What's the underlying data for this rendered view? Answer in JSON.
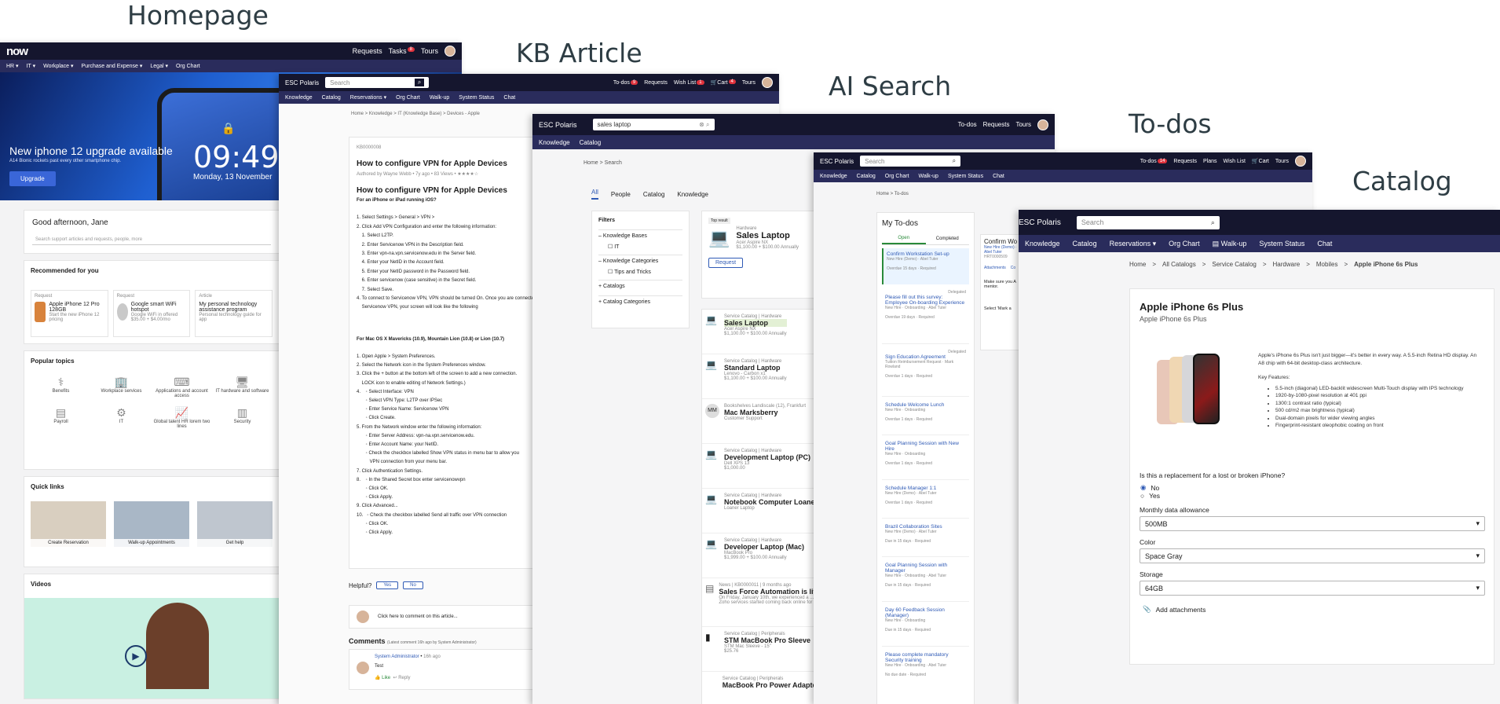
{
  "sections": {
    "homepage": "Homepage",
    "kb": "KB Article",
    "ai": "AI Search",
    "todos": "To-dos",
    "catalog": "Catalog"
  },
  "colors": {
    "topbar": "#15162e",
    "navbar": "#2a2c5c",
    "link": "#2f5ab5",
    "badge": "#e0323c"
  },
  "home": {
    "logo": "now",
    "top_links": [
      "Requests",
      "Tasks",
      "Tours"
    ],
    "tasks_badge": "8",
    "nav": [
      "HR ▾",
      "IT ▾",
      "Workplace ▾",
      "Purchase and Expense ▾",
      "Legal ▾",
      "Org Chart"
    ],
    "hero_title": "New iphone 12 upgrade available",
    "hero_sub": "A14 Bionic rockets past every other smartphone chip.",
    "hero_button": "Upgrade",
    "clock_time": "09:49",
    "clock_date": "Monday, 13 November",
    "greeting": "Good afternoon, Jane",
    "search_placeholder": "Search support articles and requests, people, more",
    "recommended_title": "Recommended for you",
    "recs": [
      {
        "kind": "Request",
        "title": "Apple iPhone 12 Pro 128GB",
        "desc": "Start the new iPhone 12 pricing"
      },
      {
        "kind": "Request",
        "title": "Google smart WiFi hotspot",
        "desc": "Google WiFi in offered $35.00 + $4.00/mo"
      },
      {
        "kind": "Article",
        "title": "My personal technology assistance program",
        "desc": "Personal technology guide for app"
      }
    ],
    "topics_title": "Popular topics",
    "topics": [
      "Benefits",
      "Workplace services",
      "Applications and account access",
      "IT hardware and software",
      "Payroll",
      "IT",
      "Global talent HR lorem two lines",
      "Security"
    ],
    "quick_title": "Quick links",
    "quick": [
      "Create Reservation",
      "Walk-up Appointments",
      "Get help"
    ],
    "videos_title": "Videos"
  },
  "kb": {
    "brand": "ESC Polaris",
    "search_placeholder": "Search",
    "top_links": [
      "To-dos",
      "Requests",
      "Wish List",
      "Cart",
      "Tours"
    ],
    "todo_badge": "9",
    "wish_badge": "1",
    "cart_badge": "4",
    "nav": [
      "Knowledge",
      "Catalog",
      "Reservations ▾",
      "Org Chart",
      "Walk-up",
      "System Status",
      "Chat"
    ],
    "breadcrumb": [
      "Home",
      "Knowledge",
      "IT (Knowledge Base)",
      "Devices - Apple"
    ],
    "number": "KB0000008",
    "title": "How to configure VPN for Apple Devices",
    "meta": "Authored by Wayne Webb • 7y ago • 83 Views • ★★★★☆",
    "heading": "How to configure VPN for Apple Devices",
    "ios_heading": "For an iPhone or iPad running iOS?",
    "lines": [
      "1. Select Settings > General > VPN >",
      "2. Click Add VPN Configuration and enter the following information:",
      "    1. Select L2TP.",
      "    2. Enter Servicenow VPN in the Description field.",
      "    3. Enter vpn-na.vpn.servicenow.edu in the Server field.",
      "    4. Enter your NetID in the Account field.",
      "    5. Enter your NetID password in the Password field.",
      "    6. Enter servicenow (case sensitive) in the Secret field.",
      "    7. Select Save.",
      "4. To connect to Servicenow VPN, VPN should be turned On. Once you are connected to",
      "    Servicenow VPN, your screen will look like the following"
    ],
    "mac_heading": "For Mac OS X Mavericks (10.9), Mountain Lion (10.8) or Lion (10.7)",
    "mac_lines": [
      "1. Open Apple > System Preferences.",
      "2. Select the Network icon in the System Preferences window.",
      "3. Click the + button at the bottom left of the screen to add a new connection.",
      "    LOCK icon to enable editing of Network Settings.)",
      "4.    ◦ Select Interface: VPN",
      "       ◦ Select VPN Type: L2TP over IPSec",
      "       ◦ Enter Service Name: Servicenow VPN",
      "       ◦ Click Create.",
      "5. From the Network window enter the following information:",
      "       ◦ Enter Server Address: vpn-na.vpn.servicenow.edu.",
      "       ◦ Enter Account Name: your NetID.",
      "       ◦ Check the checkbox labelled Show VPN status in menu bar to allow you",
      "          VPN connection from your menu bar.",
      "7. Click Authentication Settings.",
      "8.    ◦ In the Shared Secret box enter servicenowvpn",
      "       ◦ Click OK.",
      "       ◦ Click Apply.",
      "9. Click Advanced...",
      "10.   ◦ Check the checkbox labelled Send all traffic over VPN connection",
      "       ◦ Click OK.",
      "       ◦ Click Apply."
    ],
    "helpful": "Helpful?",
    "yes": "Yes",
    "no": "No",
    "comment_placeholder": "Click here to comment on this article...",
    "comments_title": "Comments",
    "comments_meta": "(Latest comment 16h ago by System Administrator)",
    "commenter": "System Administrator",
    "comment_time": "16h ago",
    "comment_text": "Test",
    "like": "Like",
    "reply": "Reply"
  },
  "ai": {
    "brand": "ESC Polaris",
    "query": "sales laptop",
    "top_links": [
      "To-dos",
      "Requests",
      "Tours"
    ],
    "nav": [
      "Knowledge",
      "Catalog"
    ],
    "breadcrumb": [
      "Home",
      "Search"
    ],
    "tabs": [
      "All",
      "People",
      "Catalog",
      "Knowledge"
    ],
    "filters_title": "Filters",
    "filters": [
      {
        "group": "Knowledge Bases",
        "items": [
          "IT"
        ]
      },
      {
        "group": "Knowledge Categories",
        "items": [
          "Tips and Tricks"
        ]
      },
      {
        "group": "Catalogs",
        "items": []
      },
      {
        "group": "Catalog Categories",
        "items": []
      }
    ],
    "top_result": {
      "badge": "Top result",
      "category": "Hardware",
      "title": "Sales Laptop",
      "sub": "Acer Aspire NX",
      "price": "$1,100.00 + $100.00 Annually",
      "button": "Request"
    },
    "results": [
      {
        "cat": "Service Catalog | Hardware",
        "title": "Sales Laptop",
        "sub": "Acer Aspire NX",
        "price": "$1,100.00 + $100.00 Annually"
      },
      {
        "cat": "Service Catalog | Hardware",
        "title": "Standard Laptop",
        "sub": "Lenovo - Carbon x1",
        "price": "$1,100.00 + $100.00 Annually"
      },
      {
        "cat": "Bookshelves Landiscale (12), Frankfurt",
        "title": "Mac Marksberry",
        "sub": "Customer Support",
        "price": ""
      },
      {
        "cat": "Service Catalog | Hardware",
        "title": "Development Laptop (PC)",
        "sub": "Dell XPS 13",
        "price": "$1,000.00"
      },
      {
        "cat": "Service Catalog | Hardware",
        "title": "Notebook Computer Loaner",
        "sub": "Loaner Laptop",
        "price": ""
      },
      {
        "cat": "Service Catalog | Hardware",
        "title": "Developer Laptop (Mac)",
        "sub": "MacBook Pro",
        "price": "$1,999.00 + $100.00 Annually"
      },
      {
        "cat": "News | KB0000011 | 9 months ago",
        "title": "Sales Force Automation is live",
        "sub": "On Friday, January 10th, we experienced a ...",
        "price": "Zoho services started coming back online for ..."
      },
      {
        "cat": "Service Catalog | Peripherals",
        "title": "STM MacBook Pro Sleeve",
        "sub": "STM Mac Sleeve - 15\"",
        "price": "$25.76"
      },
      {
        "cat": "Service Catalog | Peripherals",
        "title": "MacBook Pro Power Adapter",
        "sub": "",
        "price": ""
      }
    ]
  },
  "todos": {
    "brand": "ESC Polaris",
    "search_placeholder": "Search",
    "top_links": [
      "To-dos",
      "Requests",
      "Plans",
      "Wish List",
      "Cart",
      "Tours"
    ],
    "todo_badge": "14",
    "nav": [
      "Knowledge",
      "Catalog",
      "Org Chart",
      "Walk-up",
      "System Status",
      "Chat"
    ],
    "breadcrumb": [
      "Home",
      "To-dos"
    ],
    "title": "My To-dos",
    "tabs": [
      "Open",
      "Completed"
    ],
    "items": [
      {
        "title": "Confirm Workstation Set-up",
        "sub": "New Hire (Demo) · Abel Tuter",
        "meta": "Overdue 15 days · Required",
        "tag": ""
      },
      {
        "title": "Please fill out this survey: Employee On-boarding Experience",
        "sub": "New Hire · Onboarding · Abel Tuter",
        "meta": "Overdue 19 days · Required",
        "tag": "Delegated"
      },
      {
        "title": "Sign Education Agreement",
        "sub": "Tuition Reimbursement Request · Mark Rowland",
        "meta": "Overdue 1 days · Required",
        "tag": "Delegated"
      },
      {
        "title": "Schedule Welcome Lunch",
        "sub": "New Hire · Onboarding",
        "meta": "Overdue 1 days · Required",
        "tag": ""
      },
      {
        "title": "Goal Planning Session with New Hire",
        "sub": "New Hire · Onboarding",
        "meta": "Overdue 1 days · Required",
        "tag": ""
      },
      {
        "title": "Schedule Manager 1:1",
        "sub": "New Hire (Demo) · Abel Tuter",
        "meta": "Overdue 1 days · Required",
        "tag": ""
      },
      {
        "title": "Brazil Collaboration Sites",
        "sub": "New Hire (Demo) · Abel Tuter",
        "meta": "Due in 15 days · Required",
        "tag": ""
      },
      {
        "title": "Goal Planning Session with Manager",
        "sub": "New Hire · Onboarding · Abel Tuter",
        "meta": "Due in 15 days · Required",
        "tag": ""
      },
      {
        "title": "Day 60 Feedback Session (Manager)",
        "sub": "New Hire · Onboarding",
        "meta": "Due in 15 days · Required",
        "tag": ""
      },
      {
        "title": "Please complete mandatory Security training",
        "sub": "New Hire · Onboarding · Abel Tuter",
        "meta": "No due date · Required",
        "tag": ""
      }
    ],
    "detail_title": "Confirm Wo",
    "detail_sub": "New Hire (Demo) · Abel Tuter",
    "detail_num": "HRT0000509",
    "detail_tabs": [
      "Attachments",
      "Co"
    ],
    "detail_text": "Make sure you A mentor.",
    "detail_select": "Select 'Mark a"
  },
  "catalog": {
    "brand": "ESC Polaris",
    "search_placeholder": "Search",
    "nav": [
      "Knowledge",
      "Catalog",
      "Reservations ▾",
      "Org Chart",
      "Walk-up",
      "System Status",
      "Chat"
    ],
    "breadcrumb": [
      "Home",
      "All Catalogs",
      "Service Catalog",
      "Hardware",
      "Mobiles",
      "Apple iPhone 6s Plus"
    ],
    "title": "Apple iPhone 6s Plus",
    "subtitle": "Apple iPhone 6s Plus",
    "desc": "Apple's iPhone 6s Plus isn't just bigger—it's better in every way. A 5.5-inch Retina HD display. An A8 chip with 64-bit desktop-class architecture.",
    "features_title": "Key Features:",
    "features": [
      "5.5-inch (diagonal) LED-backlit widescreen Multi-Touch display with IPS technology",
      "1920-by-1080-pixel resolution at 401 ppi",
      "1300:1 contrast ratio (typical)",
      "500 cd/m2 max brightness (typical)",
      "Dual-domain pixels for wider viewing angles",
      "Fingerprint-resistant oleophobic coating on front"
    ],
    "question": "Is this a replacement for a lost or broken iPhone?",
    "opt_no": "No",
    "opt_yes": "Yes",
    "allowance_label": "Monthly data allowance",
    "allowance": "500MB",
    "color_label": "Color",
    "color": "Space Gray",
    "storage_label": "Storage",
    "storage": "64GB",
    "attach": "Add attachments"
  }
}
